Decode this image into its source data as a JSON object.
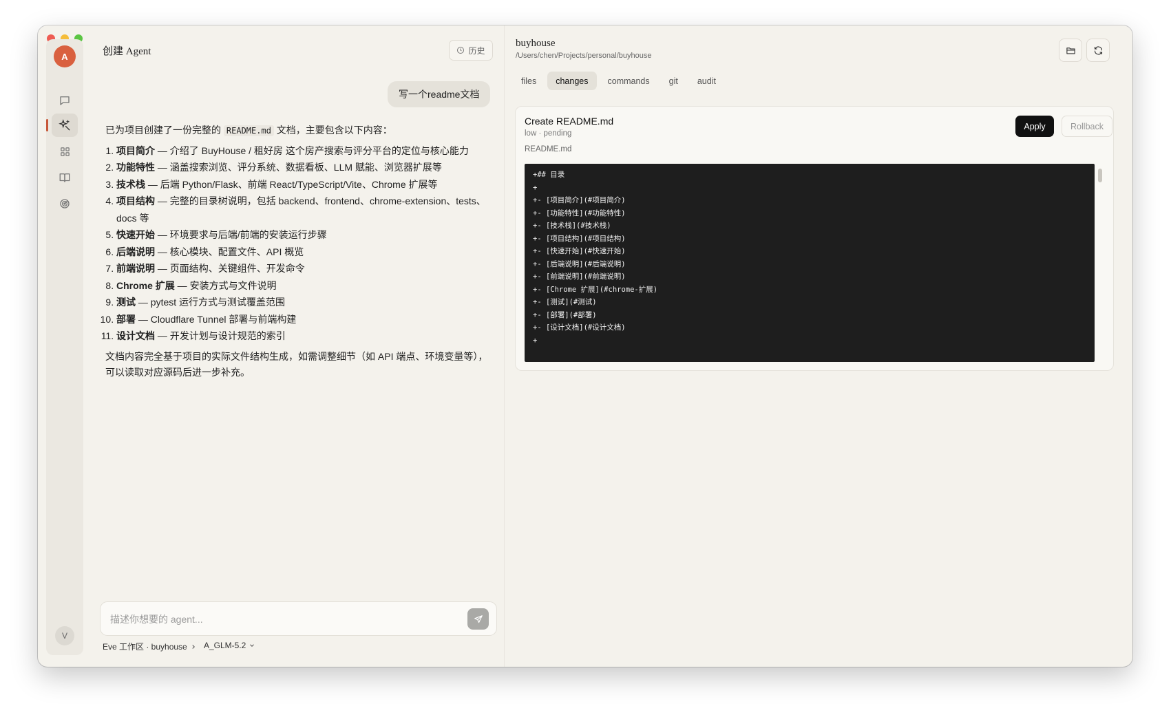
{
  "left_panel": {
    "title": "创建 Agent",
    "history_label": "历史",
    "user_message": "写一个readme文档",
    "reply": {
      "intro_before": "已为项目创建了一份完整的 ",
      "intro_code": "README.md",
      "intro_after": " 文档，主要包含以下内容：",
      "items": [
        {
          "bold": "项目简介",
          "text": " — 介绍了 BuyHouse / 租好房 这个房产搜索与评分平台的定位与核心能力"
        },
        {
          "bold": "功能特性",
          "text": " — 涵盖搜索浏览、评分系统、数据看板、LLM 赋能、浏览器扩展等"
        },
        {
          "bold": "技术栈",
          "text": " — 后端 Python/Flask、前端 React/TypeScript/Vite、Chrome 扩展等"
        },
        {
          "bold": "项目结构",
          "text": " — 完整的目录树说明，包括 backend、frontend、chrome-extension、tests、docs 等"
        },
        {
          "bold": "快速开始",
          "text": " — 环境要求与后端/前端的安装运行步骤"
        },
        {
          "bold": "后端说明",
          "text": " — 核心模块、配置文件、API 概览"
        },
        {
          "bold": "前端说明",
          "text": " — 页面结构、关键组件、开发命令"
        },
        {
          "bold": "Chrome 扩展",
          "text": " — 安装方式与文件说明"
        },
        {
          "bold": "测试",
          "text": " — pytest 运行方式与测试覆盖范围"
        },
        {
          "bold": "部署",
          "text": " — Cloudflare Tunnel 部署与前端构建"
        },
        {
          "bold": "设计文档",
          "text": " — 开发计划与设计规范的索引"
        }
      ],
      "closing": "文档内容完全基于项目的实际文件结构生成，如需调整细节（如 API 端点、环境变量等），可以读取对应源码后进一步补充。"
    },
    "input_placeholder": "描述你想要的 agent...",
    "workspace_label": "Eve 工作区 · buyhouse",
    "model_label": "A_GLM-5.2"
  },
  "right_panel": {
    "project_name": "buyhouse",
    "project_path": "/Users/chen/Projects/personal/buyhouse",
    "tabs": [
      "files",
      "changes",
      "commands",
      "git",
      "audit"
    ],
    "active_tab": "changes",
    "change": {
      "title": "Create README.md",
      "meta": "low · pending",
      "file": "README.md",
      "apply_label": "Apply",
      "rollback_label": "Rollback",
      "diff_lines": [
        "+## 目录",
        "+",
        "+- [项目简介](#项目简介)",
        "+- [功能特性](#功能特性)",
        "+- [技术栈](#技术栈)",
        "+- [项目结构](#项目结构)",
        "+- [快速开始](#快速开始)",
        "+- [后端说明](#后端说明)",
        "+- [前端说明](#前端说明)",
        "+- [Chrome 扩展](#chrome-扩展)",
        "+- [测试](#测试)",
        "+- [部署](#部署)",
        "+- [设计文档](#设计文档)",
        "+"
      ]
    }
  },
  "sidebar": {
    "avatar_top": "A",
    "avatar_bottom": "V",
    "icons": [
      "chat-icon",
      "sparkle-agent-icon",
      "grid-apps-icon",
      "book-icon",
      "radar-icon"
    ]
  },
  "colors": {
    "accent": "#d9603f",
    "window_bg": "#f4f2ec",
    "code_bg": "#1e1e1e",
    "apply_bg": "#111111"
  }
}
